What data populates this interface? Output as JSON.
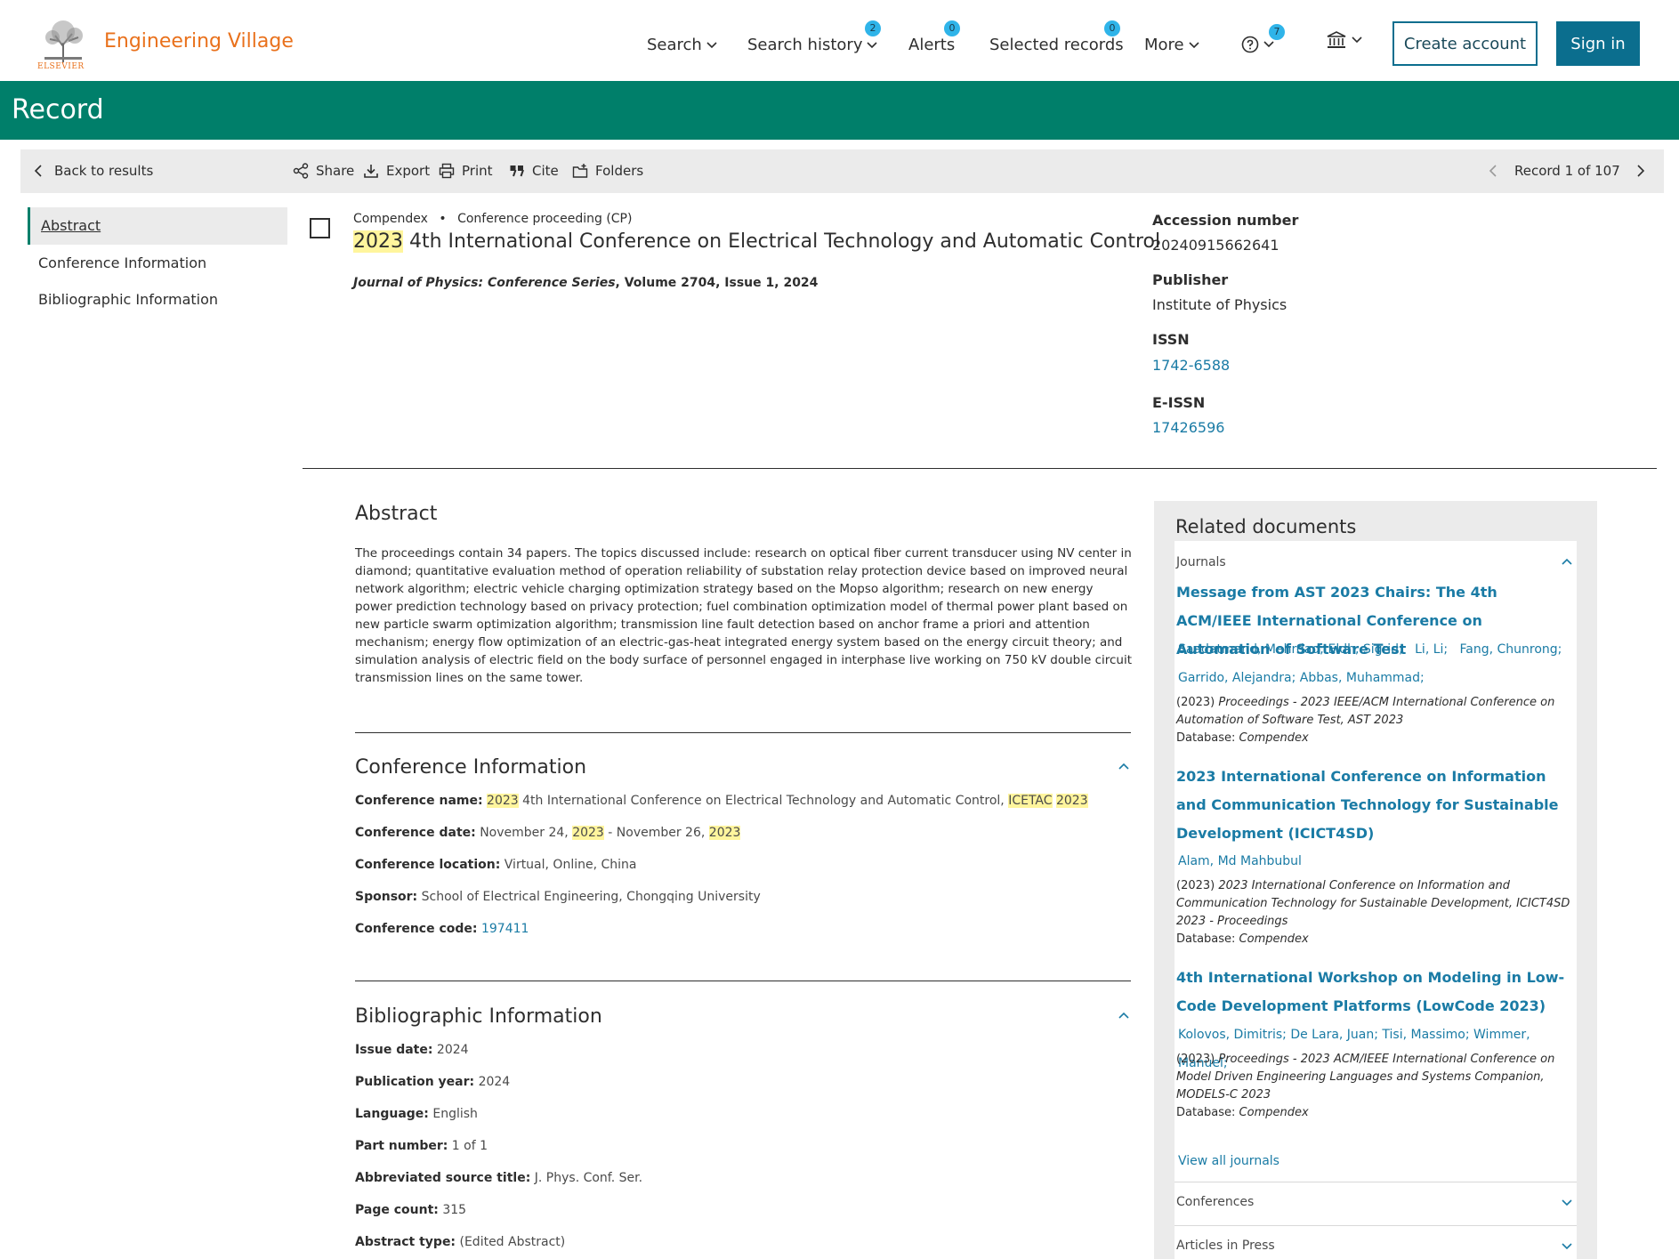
{
  "header": {
    "brand": "Engineering Village",
    "publisher_logo": "ELSEVIER",
    "nav": {
      "search": "Search",
      "search_history": "Search history",
      "search_history_badge": "2",
      "alerts": "Alerts",
      "alerts_badge": "0",
      "selected_records": "Selected records",
      "selected_records_badge": "0",
      "more": "More",
      "help_badge": "7"
    },
    "create_account": "Create account",
    "sign_in": "Sign in"
  },
  "banner": {
    "title": "Record"
  },
  "toolbar": {
    "back": "Back to results",
    "share": "Share",
    "export": "Export",
    "print": "Print",
    "cite": "Cite",
    "folders": "Folders",
    "record_position": "Record 1 of 107"
  },
  "left_nav": {
    "items": [
      "Abstract",
      "Conference Information",
      "Bibliographic Information"
    ]
  },
  "record": {
    "database": "Compendex",
    "doc_type": "Conference proceeding (CP)",
    "title_year": "2023",
    "title_rest": " 4th International Conference on Electrical Technology and Automatic Control",
    "source_journal": "Journal of Physics: Conference Series",
    "source_rest": ", Volume 2704, Issue 1, 2024"
  },
  "side_meta": {
    "accession_label": "Accession number",
    "accession_value": "20240915662641",
    "publisher_label": "Publisher",
    "publisher_value": "Institute of Physics",
    "issn_label": "ISSN",
    "issn_value": "1742-6588",
    "eissn_label": "E-ISSN",
    "eissn_value": "17426596"
  },
  "abstract": {
    "heading": "Abstract",
    "text": "The proceedings contain 34 papers. The topics discussed include: research on optical fiber current transducer using NV center in diamond; quantitative evaluation method of operation reliability of substation relay protection device based on improved neural network algorithm; electric vehicle charging optimization strategy based on the Mopso algorithm; research on new energy power prediction technology based on privacy protection; fuel combination optimization model of thermal power plant based on new particle swarm optimization algorithm; transmission line fault detection based on anchor frame a priori and attention mechanism; energy flow optimization of an electric-gas-heat integrated energy system based on the energy circuit theory; and simulation analysis of electric field on the body surface of personnel engaged in interphase live working on 750 kV double circuit transmission lines on the same tower."
  },
  "conference": {
    "heading": "Conference Information",
    "name_label": "Conference name:",
    "name_year": "2023",
    "name_rest": " 4th International Conference on Electrical Technology and Automatic Control, ",
    "name_acronym": "ICETAC",
    "name_year2": "2023",
    "date_label": "Conference date:",
    "date_start": "November 24, ",
    "date_year1": "2023",
    "date_mid": " - November 26, ",
    "date_year2": "2023",
    "location_label": "Conference location:",
    "location_value": "Virtual, Online, China",
    "sponsor_label": "Sponsor:",
    "sponsor_value": "School of Electrical Engineering, Chongqing University",
    "code_label": "Conference code:",
    "code_value": "197411"
  },
  "biblio": {
    "heading": "Bibliographic Information",
    "fields": [
      {
        "label": "Issue date:",
        "value": "2024"
      },
      {
        "label": "Publication year:",
        "value": "2024"
      },
      {
        "label": "Language:",
        "value": "English"
      },
      {
        "label": "Part number:",
        "value": "1 of 1"
      },
      {
        "label": "Abbreviated source title:",
        "value": "J. Phys. Conf. Ser."
      },
      {
        "label": "Page count:",
        "value": "315"
      },
      {
        "label": "Abstract type:",
        "value": "(Edited Abstract)"
      }
    ]
  },
  "related": {
    "heading": "Related documents",
    "journals_label": "Journals",
    "items": [
      {
        "title": "Message from AST 2023 Chairs: The 4th ACM/IEEE International Conference on Automation of Software Test",
        "authors": "Saadatmand, Mehrdad; Eldh, Sigrid;   Li, Li;   Fang, Chunrong; Garrido, Alejandra; Abbas, Muhammad;",
        "year": "(2023) ",
        "venue": "Proceedings - 2023 IEEE/ACM International Conference on Automation of Software Test, AST 2023",
        "db_label": "Database: ",
        "db": "Compendex"
      },
      {
        "title": "2023 International Conference on Information and Communication Technology for Sustainable Development (ICICT4SD)",
        "authors": "Alam, Md Mahbubul",
        "year": "(2023) ",
        "venue": "2023 International Conference on Information and Communication Technology for Sustainable Development, ICICT4SD 2023 - Proceedings",
        "db_label": "Database: ",
        "db": "Compendex"
      },
      {
        "title": "4th International Workshop on Modeling in Low-Code Development Platforms (LowCode 2023)",
        "authors": "Kolovos, Dimitris; De Lara, Juan; Tisi, Massimo; Wimmer, Manuel;",
        "year": "(2023) ",
        "venue": "Proceedings - 2023 ACM/IEEE International Conference on Model Driven Engineering Languages and Systems Companion, MODELS-C 2023",
        "db_label": "Database: ",
        "db": "Compendex"
      }
    ],
    "view_all": "View all journals",
    "conferences_label": "Conferences",
    "articles_in_press_label": "Articles in Press"
  },
  "colors": {
    "brand_orange": "#e9711c",
    "banner_green": "#007f6a",
    "link_blue": "#1a7ba5",
    "button_blue": "#0b6e8e",
    "highlight": "#fff59d",
    "badge": "#2fb4e9"
  }
}
